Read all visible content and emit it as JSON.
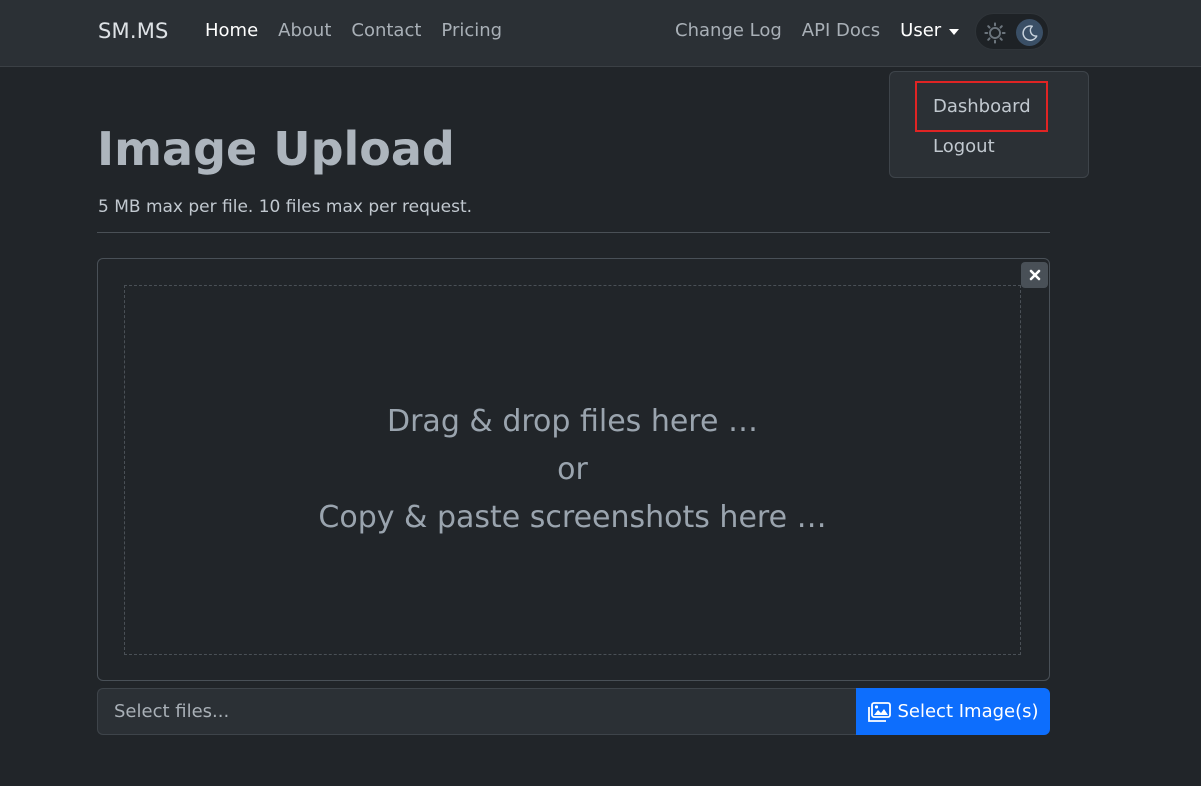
{
  "navbar": {
    "brand": "SM.MS",
    "left_links": [
      "Home",
      "About",
      "Contact",
      "Pricing"
    ],
    "right_links": [
      "Change Log",
      "API Docs"
    ],
    "user_label": "User",
    "theme_icons": [
      "sun-icon",
      "moon-icon"
    ]
  },
  "dropdown": {
    "items": [
      "Dashboard",
      "Logout"
    ]
  },
  "header": {
    "title": "Image Upload",
    "subtitle": "5 MB max per file. 10 files max per request."
  },
  "dropzone": {
    "line1": "Drag & drop files here …",
    "line2": "or",
    "line3": "Copy & paste screenshots here …",
    "close_icon": "close-icon"
  },
  "file_input": {
    "caption": "Select files...",
    "button_label": "Select Image(s)",
    "button_icon": "images-icon"
  },
  "colors": {
    "background": "#212529",
    "navbar": "#2b3035",
    "primary": "#0d6efd",
    "highlight": "#e02424"
  }
}
